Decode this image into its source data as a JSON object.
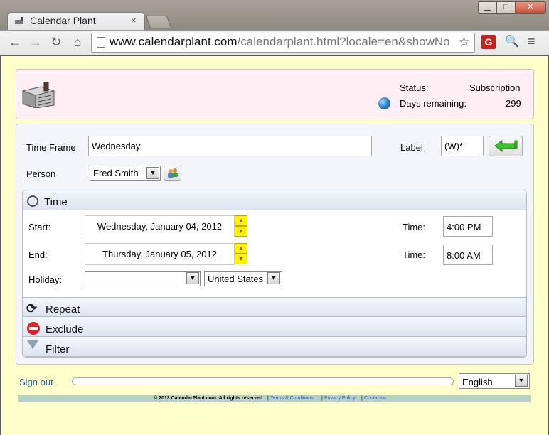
{
  "browser": {
    "tab_title": "Calendar Plant",
    "tab_close": "×",
    "url_host": "www.calendarplant.com",
    "url_rest": "/calendarplant.html?locale=en&showNo",
    "ext_letter": "G",
    "window_min": "▁",
    "window_max": "□",
    "window_close": "✕",
    "icons": {
      "back": "←",
      "forward": "→",
      "reload": "↻",
      "home": "⌂",
      "star": "☆",
      "search": "🔍",
      "menu": "≡"
    }
  },
  "header": {
    "status_label": "Status:",
    "status_value": "Subscription",
    "days_label": "Days remaining:",
    "days_value": "299"
  },
  "form": {
    "timeframe_label": "Time Frame",
    "timeframe_value": "Wednesday",
    "label_label": "Label",
    "label_value": "(W)*",
    "person_label": "Person",
    "person_value": "Fred Smith"
  },
  "sections": {
    "time": "Time",
    "repeat": "Repeat",
    "exclude": "Exclude",
    "filter": "Filter"
  },
  "time": {
    "start_label": "Start:",
    "start_date": "Wednesday, January 04, 2012",
    "end_label": "End:",
    "end_date": "Thursday, January 05, 2012",
    "time_label": "Time:",
    "start_time": "4:00 PM",
    "end_time": "8:00 AM",
    "holiday_label": "Holiday:",
    "holiday_value": "",
    "country_value": "United States",
    "spin_up": "▲",
    "spin_down": "▼",
    "dropdown_arrow": "▼"
  },
  "footer": {
    "signout": "Sign out",
    "language": "English",
    "copyright": "© 2013 CalendarPlant.com. All rights reserved",
    "terms": "Terms & Conditions",
    "privacy": "Privacy Policy",
    "contact": "Contactus",
    "separator": "|"
  },
  "colors": {
    "page_bg": "#ffffcc",
    "header_bg": "#ffeef4",
    "link": "#1d5fb3",
    "spin": "#fff200"
  }
}
